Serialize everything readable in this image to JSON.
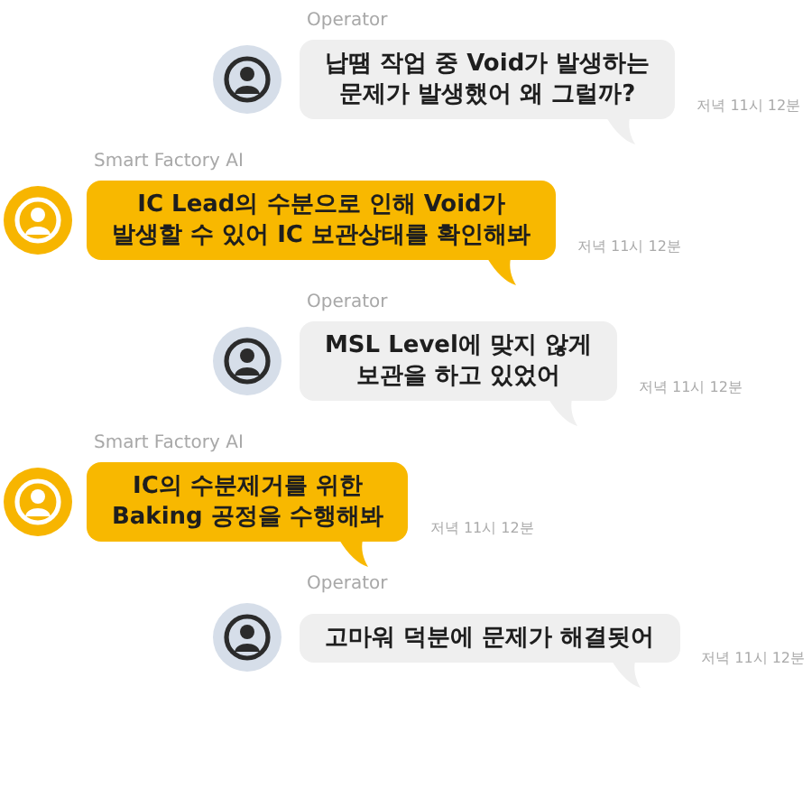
{
  "messages": [
    {
      "kind": "operator",
      "sender": "Operator",
      "text": "납땜 작업 중 Void가 발생하는\n문제가 발생했어 왜 그럴까?",
      "time": "저녁 11시 12분"
    },
    {
      "kind": "ai",
      "sender": "Smart Factory AI",
      "text": "IC Lead의 수분으로 인해 Void가\n발생할 수 있어 IC 보관상태를 확인해봐",
      "time": "저녁 11시 12분"
    },
    {
      "kind": "operator",
      "sender": "Operator",
      "text": "MSL Level에 맞지 않게\n보관을 하고 있었어",
      "time": "저녁 11시 12분"
    },
    {
      "kind": "ai",
      "sender": "Smart Factory AI",
      "text": "IC의 수분제거를 위한\nBaking 공정을 수행해봐",
      "time": "저녁 11시 12분"
    },
    {
      "kind": "operator",
      "sender": "Operator",
      "text": "고마워 덕분에 문제가 해결됫어",
      "time": "저녁 11시 12분"
    }
  ]
}
